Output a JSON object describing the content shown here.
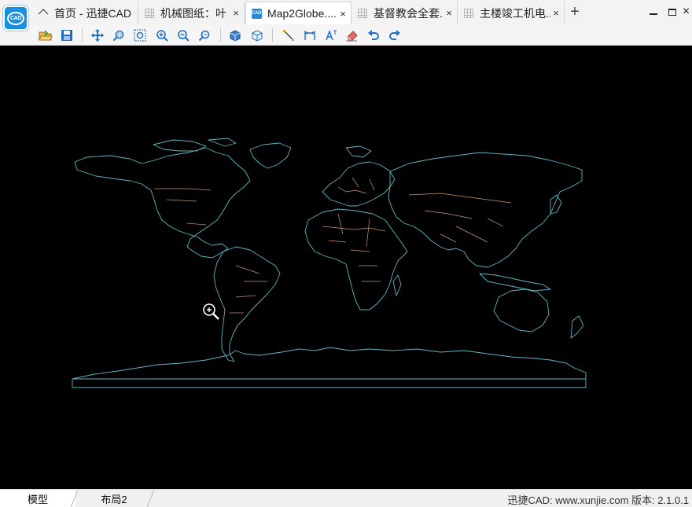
{
  "tabs": [
    {
      "label": "首页 - 迅捷CAD",
      "active": false,
      "icon": "home-icon"
    },
    {
      "label": "机械图纸：叶",
      "active": false,
      "icon": "grid-doc-icon"
    },
    {
      "label": "Map2Globe....",
      "active": true,
      "icon": "cad-doc-icon"
    },
    {
      "label": "基督教会全套...",
      "active": false,
      "icon": "grid-doc-icon"
    },
    {
      "label": "主楼竣工机电...",
      "active": false,
      "icon": "grid-doc-icon"
    }
  ],
  "tab_close_glyph": "×",
  "new_tab_glyph": "+",
  "window": {
    "close_glyph": "×"
  },
  "app_logo_text": "CAD",
  "toolbar": {
    "tools": [
      "open-icon",
      "save-icon",
      "pan-icon",
      "zoom-window-icon",
      "zoom-extents-icon",
      "zoom-in-icon",
      "zoom-out-icon",
      "zoom-previous-icon",
      "3d-view-icon",
      "3d-orbit-icon",
      "line-icon",
      "dimension-icon",
      "text-icon",
      "eraser-icon",
      "undo-icon",
      "redo-icon"
    ],
    "accent_color": "#1f6fc4"
  },
  "canvas": {
    "background": "#000000",
    "coastline_color": "#5fb6c2",
    "border_color": "#c89a6a",
    "drawing_name": "Map2Globe"
  },
  "layout_tabs": [
    {
      "label": "模型",
      "active": true
    },
    {
      "label": "布局2",
      "active": false
    }
  ],
  "status_text": "迅捷CAD: www.xunjie.com 版本: 2.1.0.1"
}
